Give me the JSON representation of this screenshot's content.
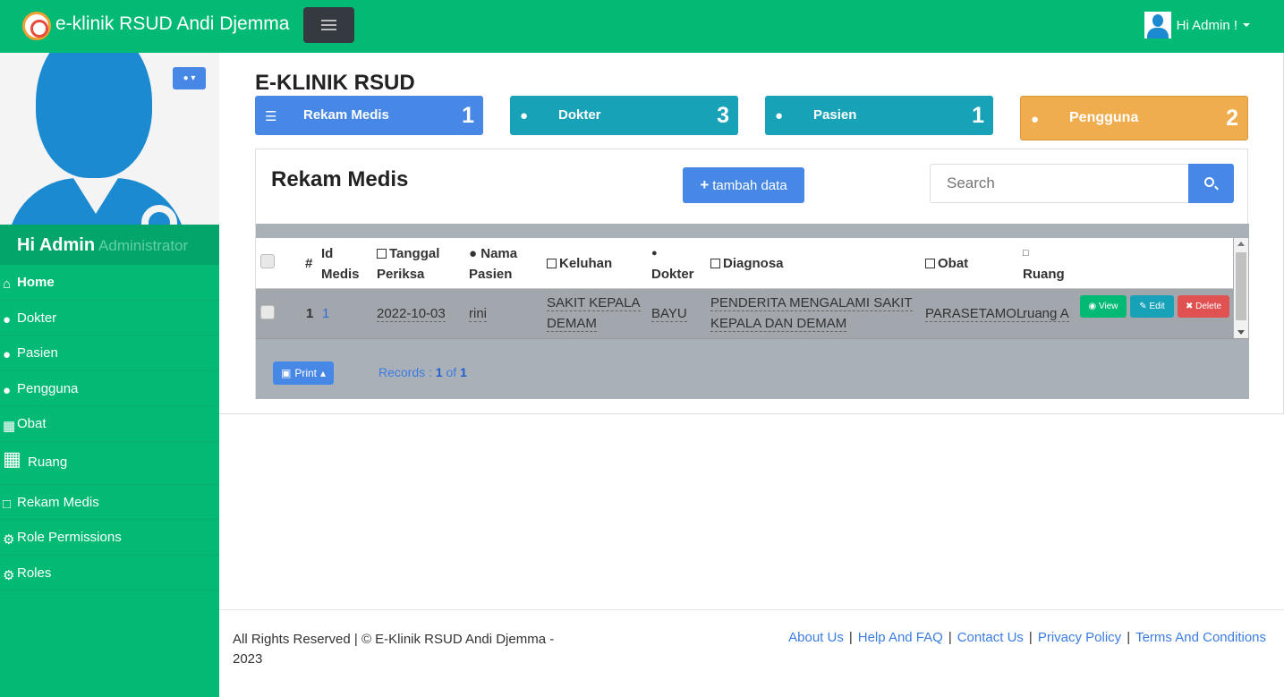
{
  "navbar": {
    "brand": "e-klinik RSUD Andi Djemma",
    "user_label": "Hi Admin !"
  },
  "sidebar": {
    "greeting": "Hi Admin",
    "role": "Administrator",
    "items": [
      {
        "label": "Home",
        "icon": "home-icon"
      },
      {
        "label": "Dokter",
        "icon": "user-md-icon"
      },
      {
        "label": "Pasien",
        "icon": "user-icon"
      },
      {
        "label": "Pengguna",
        "icon": "users-icon"
      },
      {
        "label": "Obat",
        "icon": "table-icon"
      },
      {
        "label": "Ruang",
        "icon": "hospital-icon"
      },
      {
        "label": "Rekam Medis",
        "icon": "file-icon"
      },
      {
        "label": "Role Permissions",
        "icon": "gear-icon"
      },
      {
        "label": "Roles",
        "icon": "gears-icon"
      }
    ]
  },
  "main": {
    "title": "E-KLINIK RSUD",
    "stats": [
      {
        "label": "Rekam Medis",
        "value": "1",
        "icon": "database-icon",
        "color": "#4788e6"
      },
      {
        "label": "Dokter",
        "value": "3",
        "icon": "user-md-icon",
        "color": "#17a2b8"
      },
      {
        "label": "Pasien",
        "value": "1",
        "icon": "user-icon",
        "color": "#17a2b8"
      },
      {
        "label": "Pengguna",
        "value": "2",
        "icon": "user-icon",
        "color": "#f0ad4e"
      }
    ],
    "card_title": "Rekam Medis",
    "add_button": "tambah data",
    "search_placeholder": "Search"
  },
  "table": {
    "headers": {
      "num": "#",
      "id_medis_1": "Id",
      "id_medis_2": "Medis",
      "tanggal_1": "Tanggal",
      "tanggal_2": "Periksa",
      "nama_1": "Nama",
      "nama_2": "Pasien",
      "keluhan": "Keluhan",
      "dokter": "Dokter",
      "diagnosa": "Diagnosa",
      "obat": "Obat",
      "ruang": "Ruang"
    },
    "rows": [
      {
        "num": "1",
        "id": "1",
        "tanggal": "2022-10-03",
        "nama": "rini",
        "keluhan_1": "SAKIT KEPALA",
        "keluhan_2": "DEMAM",
        "dokter": "BAYU",
        "diagnosa_1": "PENDERITA MENGALAMI SAKIT",
        "diagnosa_2": "KEPALA DAN DEMAM",
        "obat": "PARASETAMOL",
        "ruang": "ruang A",
        "view": "View",
        "edit": "Edit",
        "delete": "Delete"
      }
    ]
  },
  "pager": {
    "print": "Print",
    "records_label": "Records :",
    "records_from": "1",
    "records_of": "of",
    "records_total": "1"
  },
  "footer": {
    "copyright": "All Rights Reserved | © E-Klinik RSUD Andi Djemma - 2023",
    "links": [
      "About Us",
      "Help And FAQ",
      "Contact Us",
      "Privacy Policy",
      "Terms And Conditions"
    ]
  }
}
